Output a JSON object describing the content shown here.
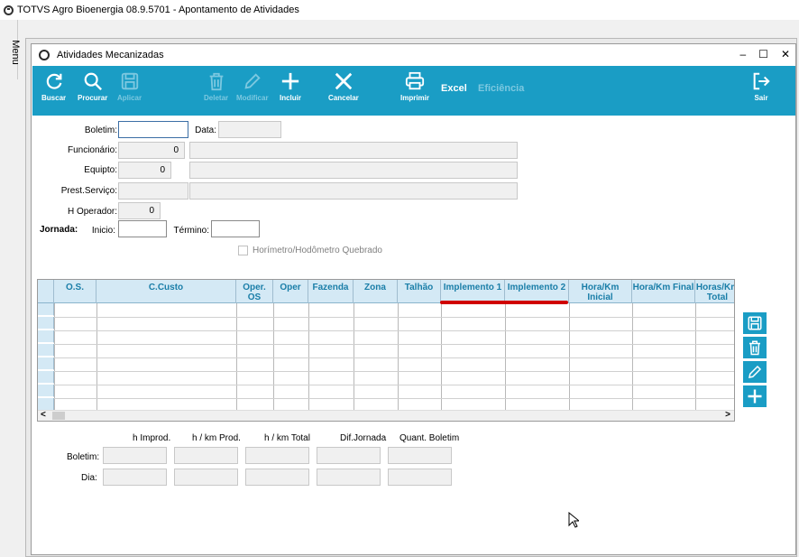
{
  "app": {
    "title": "TOTVS Agro Bioenergia 08.9.5701 - Apontamento de Atividades"
  },
  "side_menu": {
    "label": "Menu"
  },
  "window": {
    "title": "Atividades Mecanizadas"
  },
  "toolbar": {
    "buscar": "Buscar",
    "procurar": "Procurar",
    "aplicar": "Aplicar",
    "deletar": "Deletar",
    "modificar": "Modificar",
    "incluir": "Incluir",
    "cancelar": "Cancelar",
    "imprimir": "Imprimir",
    "excel": "Excel",
    "eficiencia": "Eficiência",
    "sair": "Sair"
  },
  "form": {
    "boletim_label": "Boletim:",
    "boletim_value": "",
    "data_label": "Data:",
    "funcionario_label": "Funcionário:",
    "funcionario_value": "0",
    "equipto_label": "Equipto:",
    "equipto_value": "0",
    "prest_label": "Prest.Serviço:",
    "hoperador_label": "H Operador:",
    "hoperador_value": "0",
    "jornada_label": "Jornada:",
    "inicio_label": "Inicio:",
    "termino_label": "Término:",
    "hodometro_label": "Horímetro/Hodômetro Quebrado"
  },
  "grid": {
    "columns": [
      "O.S.",
      "C.Custo",
      "Oper. OS",
      "Oper",
      "Fazenda",
      "Zona",
      "Talhão",
      "Implemento 1",
      "Implemento 2",
      "Hora/Km Inicial",
      "Hora/Km Final",
      "Horas/Km Total"
    ],
    "scroll_left": "<",
    "scroll_right": ">"
  },
  "totals": {
    "headers": [
      "h Improd.",
      "h / km Prod.",
      "h / km Total",
      "Dif.Jornada",
      "Quant. Boletim"
    ],
    "row_boletim": "Boletim:",
    "row_dia": "Dia:"
  },
  "colors": {
    "toolbar": "#1a9dc5",
    "header": "#d4e9f5",
    "highlight": "#d00000"
  }
}
